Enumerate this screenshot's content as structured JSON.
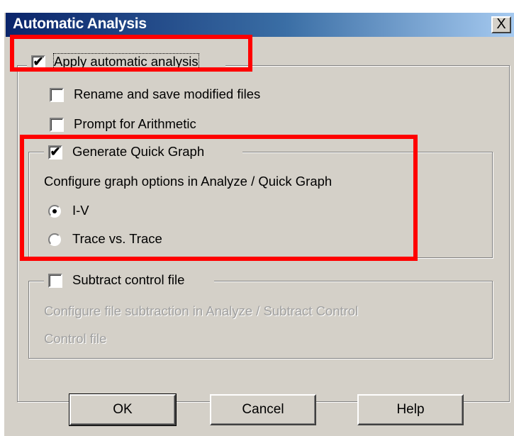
{
  "window": {
    "title": "Automatic Analysis",
    "close_label": "X"
  },
  "options": {
    "apply_analysis": {
      "label": "Apply automatic analysis",
      "checked": true
    },
    "rename_save": {
      "label": "Rename and save modified files",
      "checked": false
    },
    "prompt_arithmetic": {
      "label": "Prompt for Arithmetic",
      "checked": false
    }
  },
  "quick_graph": {
    "label": "Generate Quick Graph",
    "checked": true,
    "description": "Configure graph options in Analyze / Quick Graph",
    "radio_iv": "I-V",
    "radio_trace": "Trace vs. Trace",
    "selected": "I-V"
  },
  "subtract_control": {
    "label": "Subtract control file",
    "checked": false,
    "description": "Configure file subtraction in Analyze / Subtract Control",
    "control_file_label": "Control file"
  },
  "buttons": {
    "ok": "OK",
    "cancel": "Cancel",
    "help": "Help"
  },
  "colors": {
    "highlight": "#ff0000",
    "titlebar": "#0a246a",
    "dialog_bg": "#d4d0c8"
  }
}
